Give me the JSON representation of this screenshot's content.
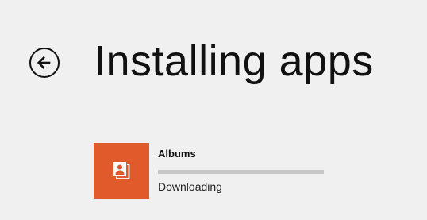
{
  "header": {
    "title": "Installing apps",
    "back_icon": "back-arrow-icon"
  },
  "install_queue": [
    {
      "name": "Albums",
      "status": "Downloading",
      "progress_percent": 0,
      "tile_color": "#e05a2b",
      "icon": "photo-albums-icon"
    }
  ],
  "colors": {
    "background": "#f0f0f0",
    "text": "#111111",
    "progress_track": "#c6c6c6"
  }
}
